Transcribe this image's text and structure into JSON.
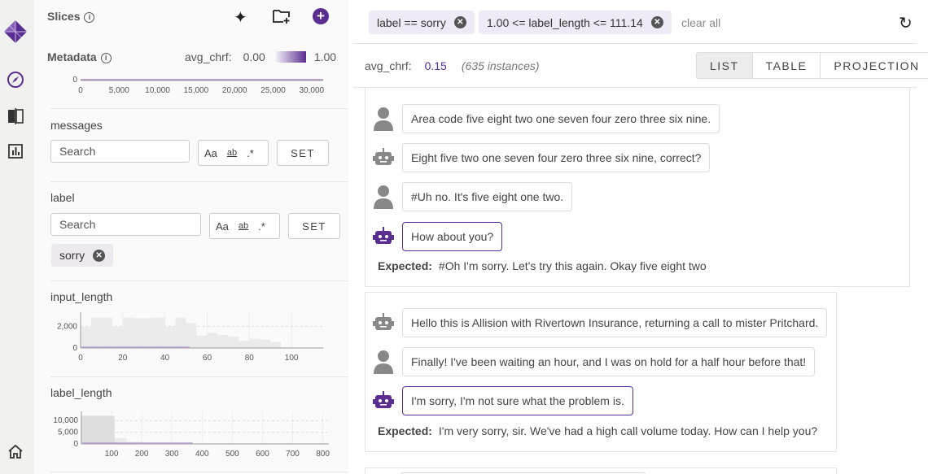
{
  "colors": {
    "accent": "#5a2e91",
    "chip_bg": "#efeaf5"
  },
  "sidebar": {
    "slices_title": "Slices",
    "metadata_title": "Metadata",
    "color_metric": "avg_chrf:",
    "color_min": "0.00",
    "color_max": "1.00",
    "fields": [
      {
        "name": "messages",
        "search_placeholder": "Search",
        "case_label": "Aa",
        "word_label": "ab",
        "regex_label": ".*",
        "set_label": "SET"
      },
      {
        "name": "label",
        "search_placeholder": "Search",
        "case_label": "Aa",
        "word_label": "ab",
        "regex_label": ".*",
        "set_label": "SET",
        "selected_tag": "sorry"
      },
      {
        "name": "input_length"
      },
      {
        "name": "label_length"
      }
    ]
  },
  "chart_data": [
    {
      "type": "bar",
      "title": "",
      "x_ticks": [
        "0",
        "5,000",
        "10,000",
        "15,000",
        "20,000",
        "25,000",
        "30,000"
      ],
      "xlim": [
        0,
        31500
      ],
      "y_ticks": [
        "0"
      ],
      "note_partial": true
    },
    {
      "type": "bar",
      "field": "input_length",
      "bin_starts": [
        0,
        5,
        10,
        15,
        20,
        25,
        30,
        35,
        40,
        45,
        50,
        55,
        60,
        65,
        70,
        75,
        80,
        85,
        90,
        95,
        100,
        105
      ],
      "values": [
        1950,
        2800,
        2800,
        1950,
        2800,
        2750,
        2750,
        2800,
        1950,
        2800,
        2300,
        1150,
        1400,
        1200,
        1050,
        650,
        850,
        750,
        550,
        20,
        20,
        10
      ],
      "bin_width": 5,
      "xlim": [
        0,
        115
      ],
      "ylim": [
        0,
        3000
      ],
      "x_ticks": [
        "0",
        "20",
        "40",
        "60",
        "80",
        "100"
      ],
      "y_ticks": [
        "0",
        "2,000"
      ],
      "grid": true
    },
    {
      "type": "bar",
      "field": "label_length",
      "bin_starts": [
        0,
        110,
        150,
        200,
        250
      ],
      "values": [
        12000,
        2500,
        900,
        300,
        100
      ],
      "bin_widths": [
        110,
        40,
        50,
        50,
        50
      ],
      "xlim": [
        0,
        820
      ],
      "ylim": [
        0,
        12500
      ],
      "x_ticks": [
        "100",
        "200",
        "300",
        "400",
        "500",
        "600",
        "700",
        "800"
      ],
      "y_ticks": [
        "0",
        "5,000",
        "10,000"
      ],
      "grid": true
    }
  ],
  "filters": {
    "chips": [
      "label == sorry",
      "1.00 <= label_length <= 111.14"
    ],
    "clear_all": "clear all"
  },
  "summary": {
    "metric": "avg_chrf:",
    "value": "0.15",
    "count": "(635 instances)"
  },
  "view_tabs": [
    "LIST",
    "TABLE",
    "PROJECTION"
  ],
  "cards": [
    {
      "messages": [
        {
          "role": "user",
          "text": "Area code five eight two one seven four zero three six nine."
        },
        {
          "role": "bot",
          "text": "Eight five two one seven four zero three six nine, correct?"
        },
        {
          "role": "user",
          "text": "#Uh no. It's five eight one two."
        },
        {
          "role": "bot",
          "text": "How about you?",
          "highlight": true
        }
      ],
      "expected_label": "Expected:",
      "expected": "#Oh I'm sorry. Let's try this again. Okay five eight two"
    },
    {
      "messages": [
        {
          "role": "bot",
          "text": "Hello this is Allision with Rivertown Insurance, returning a call to mister Pritchard."
        },
        {
          "role": "user",
          "text": "Finally! I've been waiting an hour, and I was on hold for a half hour before that!"
        },
        {
          "role": "bot",
          "text": "I'm sorry, I'm not sure what the problem is.",
          "highlight": true
        }
      ],
      "expected_label": "Expected:",
      "expected": "I'm very sorry, sir. We've had a high call volume today. How can I help you?"
    }
  ]
}
